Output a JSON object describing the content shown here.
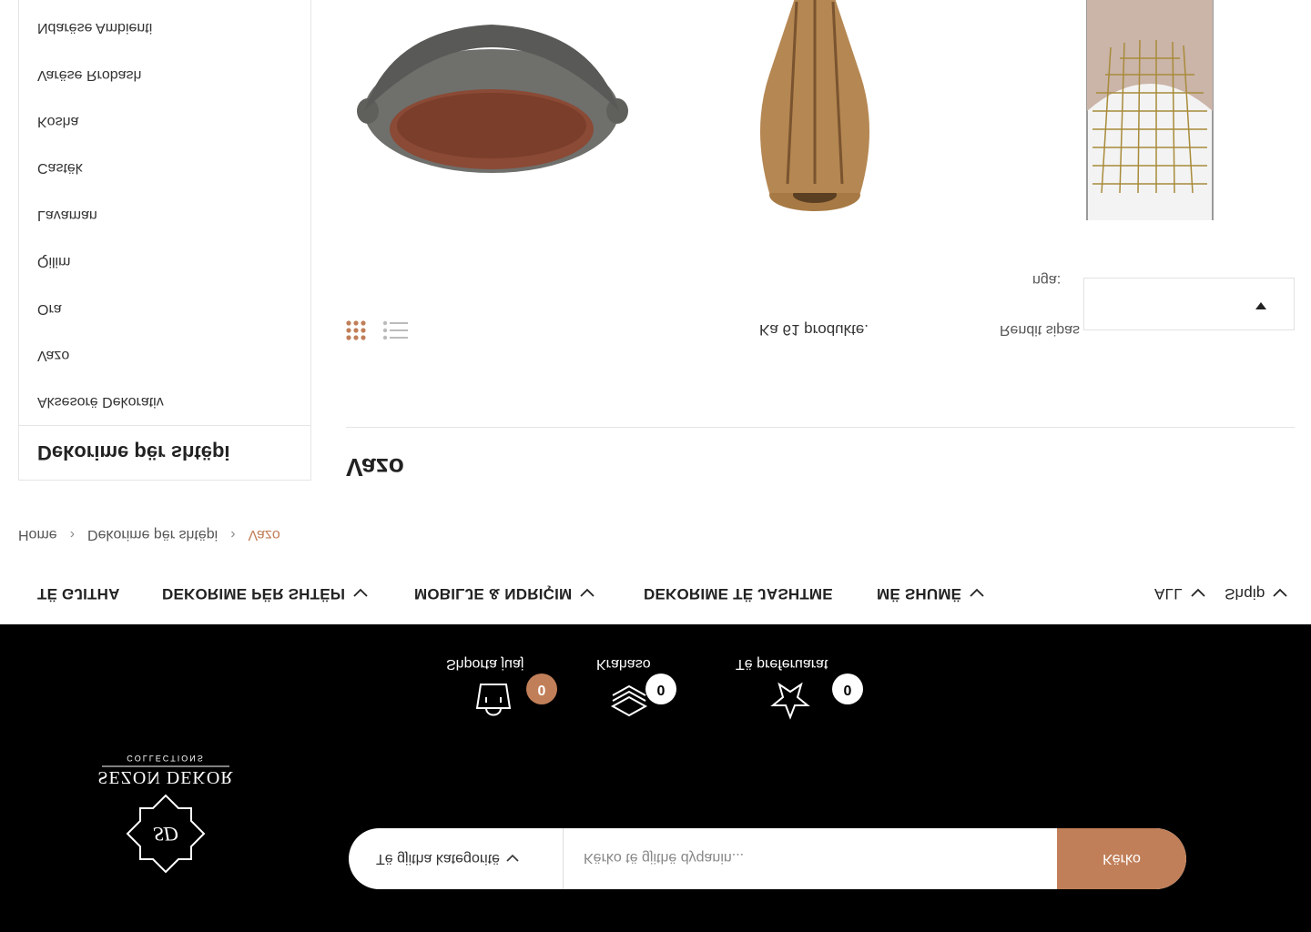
{
  "header": {
    "brand_logo_alt": "SEZON DEKOR",
    "brand_logo_sub": "COLLECTIONS",
    "brand_logo_monogram": "SD",
    "search": {
      "category_label": "Të gjitha kategoritë",
      "placeholder": "Kërko të gjithë dyqanin...",
      "button_label": "Kërko"
    },
    "tools": {
      "cart": {
        "label": "Shporta juaj",
        "count": "0"
      },
      "compare": {
        "label": "Krahaso",
        "count": "0"
      },
      "wishlist": {
        "label": "Të preferuarat",
        "count": "0"
      }
    },
    "colors": {
      "background": "#000000",
      "accent": "#c17f59"
    }
  },
  "nav": {
    "items": [
      {
        "label": "TË GJITHA"
      },
      {
        "label": "DEKORIME PËR SHTËPI"
      },
      {
        "label": "MOBILJE & NDRIÇIM"
      },
      {
        "label": "DEKORIME TË JASHTME"
      },
      {
        "label": "MË SHUMË"
      }
    ],
    "currency": "ALL",
    "language": "Shqip"
  },
  "breadcrumb": {
    "home": "Home",
    "parent": "Dekorime për shtëpi",
    "current": "Vazo"
  },
  "sidebar": {
    "title": "Dekorime për shtëpi",
    "items": [
      "Aksesorë Dekorativ",
      "Vazo",
      "Ora",
      "Qilim",
      "Lavaman",
      "Castëk",
      "Kosha",
      "Varëse Rrobash",
      "Ndarëse Ambienti"
    ]
  },
  "main": {
    "title": "Vazo",
    "count_text": "Ka 61 produkte.",
    "sort_label": "Rendit sipas",
    "sort_suffix": "nga:",
    "sort_value": "",
    "view_active": "grid"
  },
  "products": [
    {
      "name": "stone-bowl",
      "icon": "stone-bowl-image"
    },
    {
      "name": "wooden-lamp",
      "icon": "wood-lamp-image"
    },
    {
      "name": "wire-lamp",
      "icon": "wire-lamp-image"
    }
  ]
}
